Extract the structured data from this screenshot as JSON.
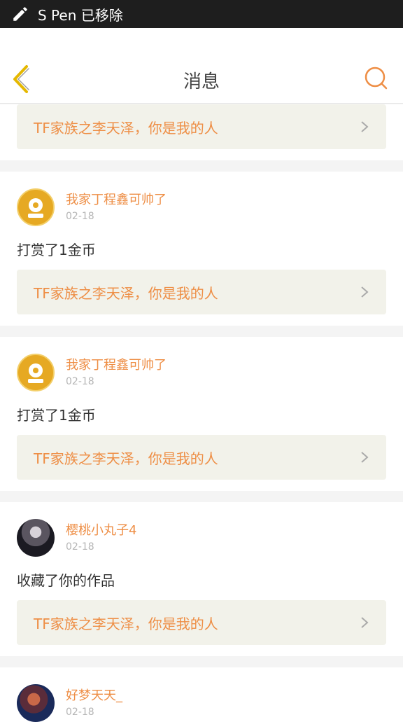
{
  "statusbar": {
    "text": "S Pen 已移除"
  },
  "appbar": {
    "title": "消息"
  },
  "colors": {
    "accent": "#ee8e45",
    "back": "#e5b800",
    "work_bg": "#f2f2ea"
  },
  "first_card": {
    "work_title": "TF家族之李天泽，你是我的人"
  },
  "cards": [
    {
      "name": "我家丁程鑫可帅了",
      "date": "02-18",
      "action": "打赏了1金币",
      "work_title": "TF家族之李天泽，你是我的人"
    },
    {
      "name": "我家丁程鑫可帅了",
      "date": "02-18",
      "action": "打赏了1金币",
      "work_title": "TF家族之李天泽，你是我的人"
    },
    {
      "name": "樱桃小丸子4",
      "date": "02-18",
      "action": "收藏了你的作品",
      "work_title": "TF家族之李天泽，你是我的人"
    },
    {
      "name": "好梦天天_",
      "date": "02-18"
    }
  ]
}
